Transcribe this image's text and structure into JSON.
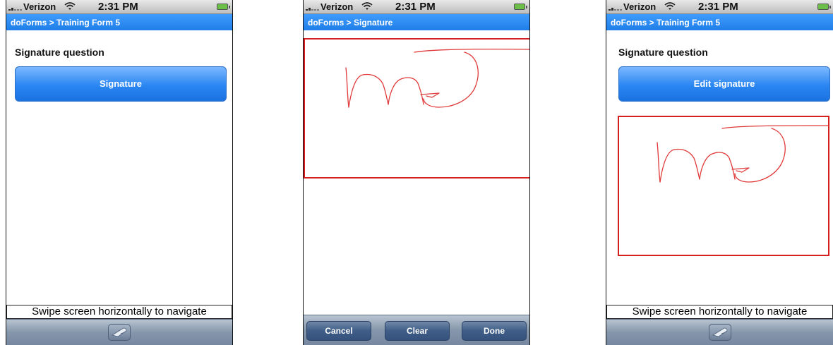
{
  "status": {
    "carrier": "Verizon",
    "time": "2:31 PM"
  },
  "screens": [
    {
      "nav_title": "doForms > Training Form 5",
      "question": "Signature question",
      "button_label": "Signature",
      "hint": "Swipe screen horizontally to navigate"
    },
    {
      "nav_title": "doForms > Signature",
      "buttons": {
        "cancel": "Cancel",
        "clear": "Clear",
        "done": "Done"
      }
    },
    {
      "nav_title": "doForms > Training Form 5",
      "question": "Signature question",
      "button_label": "Edit signature",
      "hint": "Swipe screen horizontally to navigate"
    }
  ],
  "colors": {
    "nav_blue": "#1f7ee8",
    "signature_red": "#e03a3a",
    "frame_red": "#d62020"
  },
  "icons": [
    "signal-bars-icon",
    "wifi-icon",
    "battery-icon",
    "page-curl-icon"
  ]
}
